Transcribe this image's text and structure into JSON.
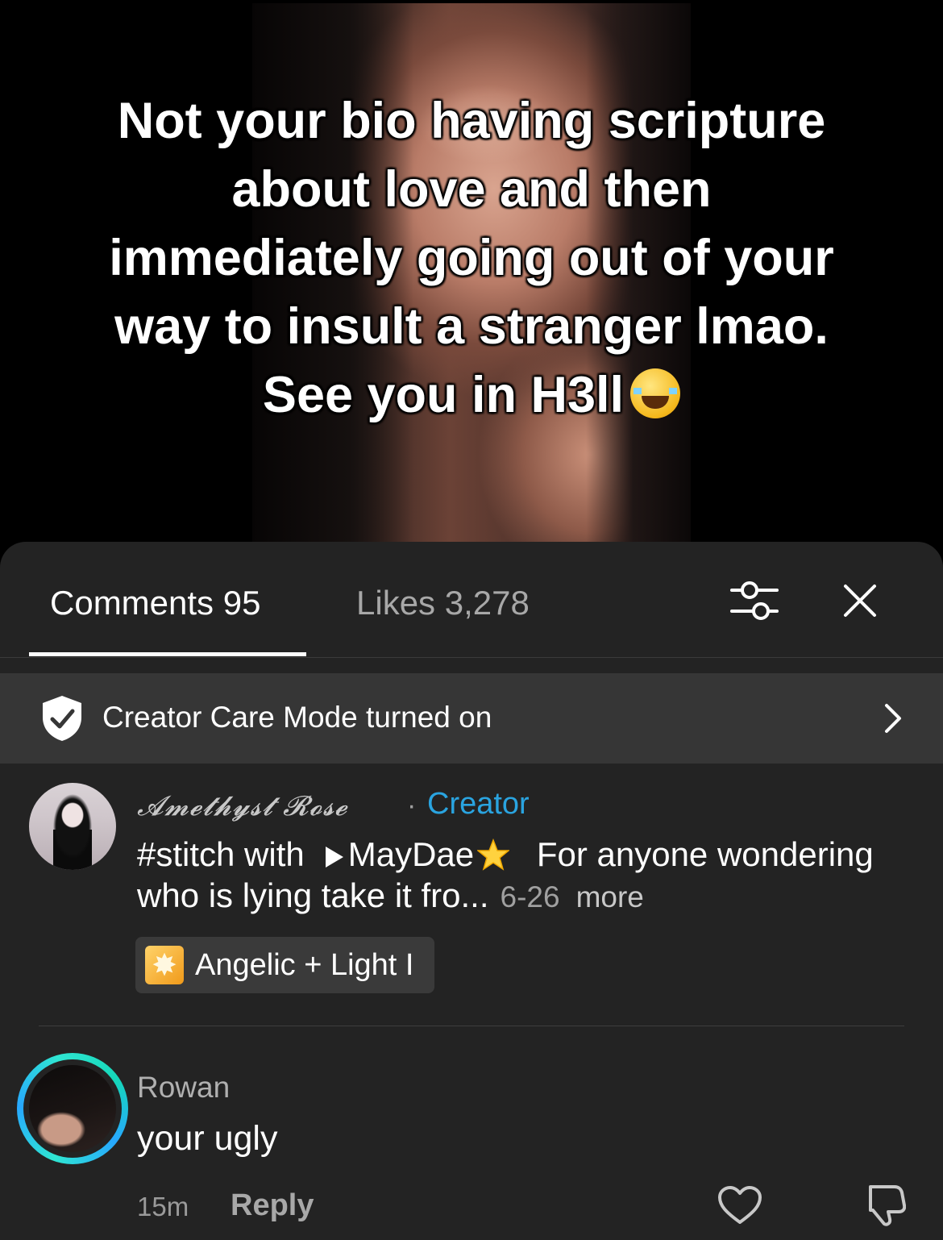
{
  "video": {
    "caption": "Not your bio having scripture about love and then immediately going out of your way to insult a stranger lmao. See you in H3ll",
    "caption_emoji": "face-with-tears-of-joy"
  },
  "panel": {
    "tabs": {
      "comments_label": "Comments 95",
      "likes_label": "Likes 3,278"
    },
    "icons": [
      "sliders-icon",
      "close-icon"
    ],
    "creator_care": {
      "text": "Creator Care Mode turned on",
      "icon": "shield-check-icon"
    },
    "comments": [
      {
        "author": "𝓐𝓶𝓮𝓽𝓱𝔂𝓼𝓽 𝓡𝓸𝓼𝓮",
        "separator": "·",
        "badge": "Creator",
        "text_prefix": "#stitch with",
        "mention": "MayDae",
        "text_rest": "For anyone wondering who is lying take it fro...",
        "date": "6-26",
        "more_label": "more",
        "sound_label": "Angelic + Light I"
      },
      {
        "author": "Rowan",
        "text": "your ugly",
        "time": "15m",
        "reply_label": "Reply"
      }
    ]
  },
  "colors": {
    "panel_bg": "#232323",
    "care_bar_bg": "#363636",
    "creator_badge": "#2aa4e0",
    "story_ring": "#2fe6d2"
  }
}
